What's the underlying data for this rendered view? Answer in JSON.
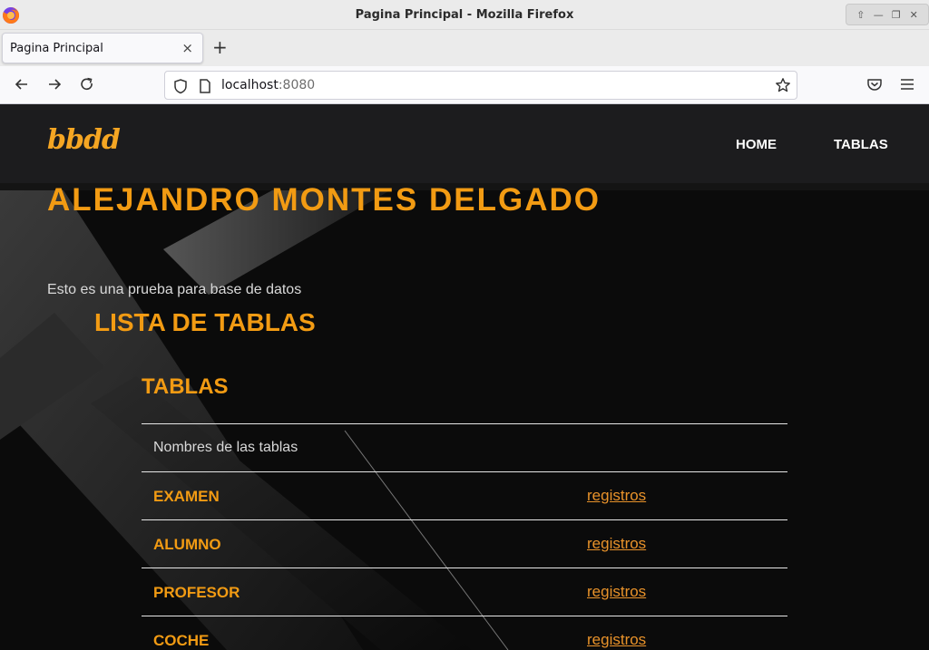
{
  "window": {
    "title": "Pagina Principal - Mozilla Firefox",
    "controls": [
      "⇧",
      "—",
      "❐",
      "✕"
    ]
  },
  "browser": {
    "tab_label": "Pagina Principal",
    "tab_close": "×",
    "new_tab": "+",
    "url_host": "localhost",
    "url_port": ":8080"
  },
  "site": {
    "brand": "bbdd",
    "nav": {
      "home": "HOME",
      "tablas": "TABLAS"
    },
    "hero_name": "ALEJANDRO MONTES DELGADO",
    "intro": "Esto es una prueba para base de datos",
    "section_title": "LISTA DE TABLAS",
    "card_title": "TABLAS",
    "table_header": "Nombres de las tablas",
    "rows": [
      {
        "name": "EXAMEN",
        "link": "registros"
      },
      {
        "name": "ALUMNO",
        "link": "registros"
      },
      {
        "name": "PROFESOR",
        "link": "registros"
      },
      {
        "name": "COCHE",
        "link": "registros"
      }
    ]
  },
  "colors": {
    "accent": "#f29b13",
    "header_bg": "#1c1c1e",
    "page_bg": "#0d0d0d"
  }
}
